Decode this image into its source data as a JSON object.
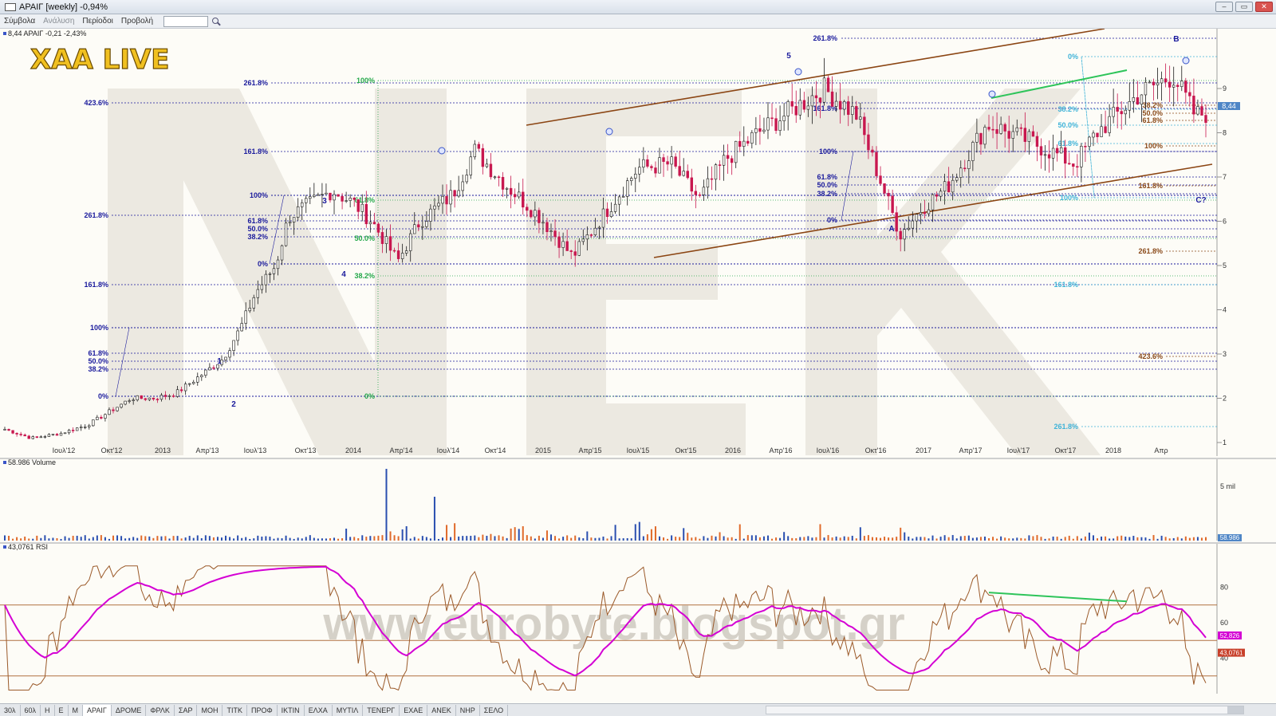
{
  "window": {
    "title": "ΑΡΑΙΓ [weekly] -0,94%",
    "buttons": [
      "–",
      "▭",
      "✕"
    ]
  },
  "menu": {
    "items": [
      "Σύμβολα",
      "Ανάλυση",
      "Περίοδοι",
      "Προβολή"
    ],
    "search_value": ""
  },
  "toolbar": {
    "icons": [
      "cursor-icon",
      "crosshair-icon",
      "rect-icon",
      "line-icon",
      "window-icon",
      "layout-icon"
    ]
  },
  "price_panel": {
    "legend": "8,44 ΑΡΑΙΓ -0,21 -2,43%",
    "watermark_logo": "XAA LIVE",
    "watermark_big": "NEK",
    "current_price_label": "8,44",
    "y_ticks": [
      "9",
      "8",
      "7",
      "6",
      "5",
      "4",
      "3",
      "2",
      "1"
    ],
    "x_ticks": [
      "Ιουλ'12",
      "Οκτ'12",
      "2013",
      "Απρ'13",
      "Ιουλ'13",
      "Οκτ'13",
      "2014",
      "Απρ'14",
      "Ιουλ'14",
      "Οκτ'14",
      "2015",
      "Απρ'15",
      "Ιουλ'15",
      "Οκτ'15",
      "2016",
      "Απρ'16",
      "Ιουλ'16",
      "Οκτ'16",
      "2017",
      "Απρ'17",
      "Ιουλ'17",
      "Οκτ'17",
      "2018",
      "Απρ"
    ],
    "wave_labels": [
      "1",
      "2",
      "3",
      "4",
      "5",
      "A",
      "B",
      "C?"
    ],
    "fib_labels_left": [
      "261.8%",
      "423.6%",
      "161.8%",
      "100%",
      "261.8%",
      "61.8%",
      "50.0%",
      "38.2%",
      "0%",
      "161.8%",
      "100%",
      "61.8%",
      "50.0%",
      "38.2%",
      "0%"
    ],
    "fib_labels_green": [
      "100%",
      "61.8%",
      "50.0%",
      "38.2%",
      "0%"
    ],
    "fib_labels_mid": [
      "261.8%",
      "161.8%",
      "100%",
      "61.8%",
      "50.0%",
      "38.2%",
      "0%"
    ],
    "fib_labels_cyan": [
      "0%",
      "38.2%",
      "50.0%",
      "61.8%",
      "100%",
      "161.8%",
      "261.8%"
    ],
    "fib_labels_brown": [
      "38.2%",
      "50.0%",
      "61.8%",
      "100%",
      "161.8%",
      "261.8%",
      "423.6%"
    ]
  },
  "volume_panel": {
    "legend": "58.986 Volume",
    "y_tick": "5 mil",
    "value_label": "58.986"
  },
  "rsi_panel": {
    "legend": "43,0761 RSI",
    "y_ticks": [
      "80",
      "60",
      "40"
    ],
    "ma_label": "52,826",
    "rsi_label": "43,0761",
    "watermark": "www.eurobyte.blogspot.gr"
  },
  "tabs": {
    "items": [
      "30λ",
      "60λ",
      "Η",
      "Ε",
      "Μ",
      "ΑΡΑΙΓ",
      "ΔΡΟΜΕ",
      "ΦΡΛΚ",
      "ΣΑΡ",
      "ΜΟΗ",
      "ΤΙΤΚ",
      "ΠΡΟΦ",
      "ΙΚΤΙΝ",
      "ΕΛΧΑ",
      "ΜΥΤΙΛ",
      "ΤΕΝΕΡΓ",
      "ΕΧΑΕ",
      "ΑΝΕΚ",
      "ΝΗΡ",
      "ΣΕΛΟ"
    ],
    "selected": "ΑΡΑΙΓ"
  },
  "colors": {
    "background": "#fdfcf7",
    "bull": "#1a1a1a",
    "bear": "#c8174f",
    "fib_blue": "#1a1a9c",
    "fib_green": "#24a84a",
    "fib_cyan": "#3fb3d8",
    "fib_brown": "#8a4a1a",
    "channel": "#8b4513",
    "rsi": "#9b5a2a",
    "rsi_ma": "#d400d4",
    "vol_up": "#2a4fb0",
    "vol_down": "#e06a2a"
  }
}
